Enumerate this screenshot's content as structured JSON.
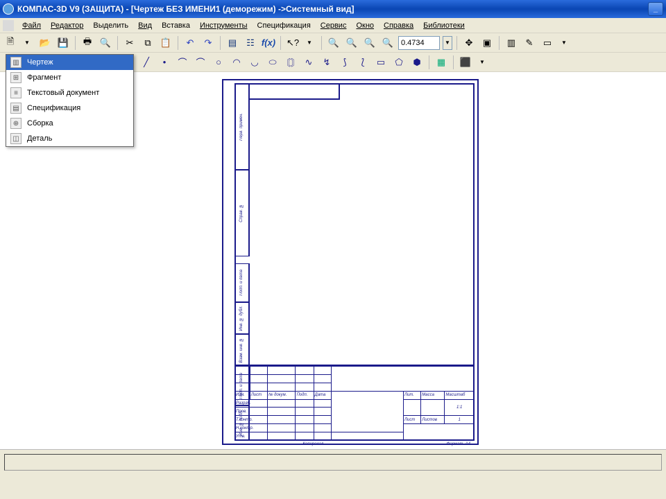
{
  "window": {
    "title": "КОМПАС-3D V9 (ЗАЩИТА) - [Чертеж БЕЗ ИМЕНИ1 (деморежим) ->Системный вид]"
  },
  "menus": {
    "file": "Файл",
    "edit": "Редактор",
    "select": "Выделить",
    "view": "Вид",
    "insert": "Вставка",
    "tools": "Инструменты",
    "spec": "Спецификация",
    "service": "Сервис",
    "window": "Окно",
    "help": "Справка",
    "libs": "Библиотеки"
  },
  "zoom": {
    "value": "0.4734"
  },
  "new_menu": {
    "items": [
      {
        "label": "Чертеж"
      },
      {
        "label": "Фрагмент"
      },
      {
        "label": "Текстовый документ"
      },
      {
        "label": "Спецификация"
      },
      {
        "label": "Сборка"
      },
      {
        "label": "Деталь"
      }
    ]
  },
  "titleblock": {
    "rows": {
      "izm": "Изм.",
      "list": "Лист",
      "ndok": "№ докум.",
      "podp": "Подп.",
      "data": "Дата",
      "razrab": "Разраб.",
      "prov": "Пров.",
      "tkontr": "Т.контр.",
      "nkontr": "Н.контр.",
      "utv": "Утв.",
      "lit": "Лит.",
      "massa": "Масса",
      "mash": "Масштаб",
      "lst": "Лист",
      "listov": "Листов",
      "listov_n": "1",
      "one_one": "1:1",
      "kopiroval": "Копировал",
      "format": "Формат",
      "a4": "A4"
    },
    "side": {
      "perv_primen": "Перв. примен.",
      "sprav_no": "Справ. №",
      "podp_data": "Подп. и дата",
      "inv_dubl": "Инв. № дубл.",
      "vzam_inv": "Взам. инв. №",
      "podp_data2": "Подп. и дата",
      "inv_podl": "Инв. № подл."
    }
  }
}
